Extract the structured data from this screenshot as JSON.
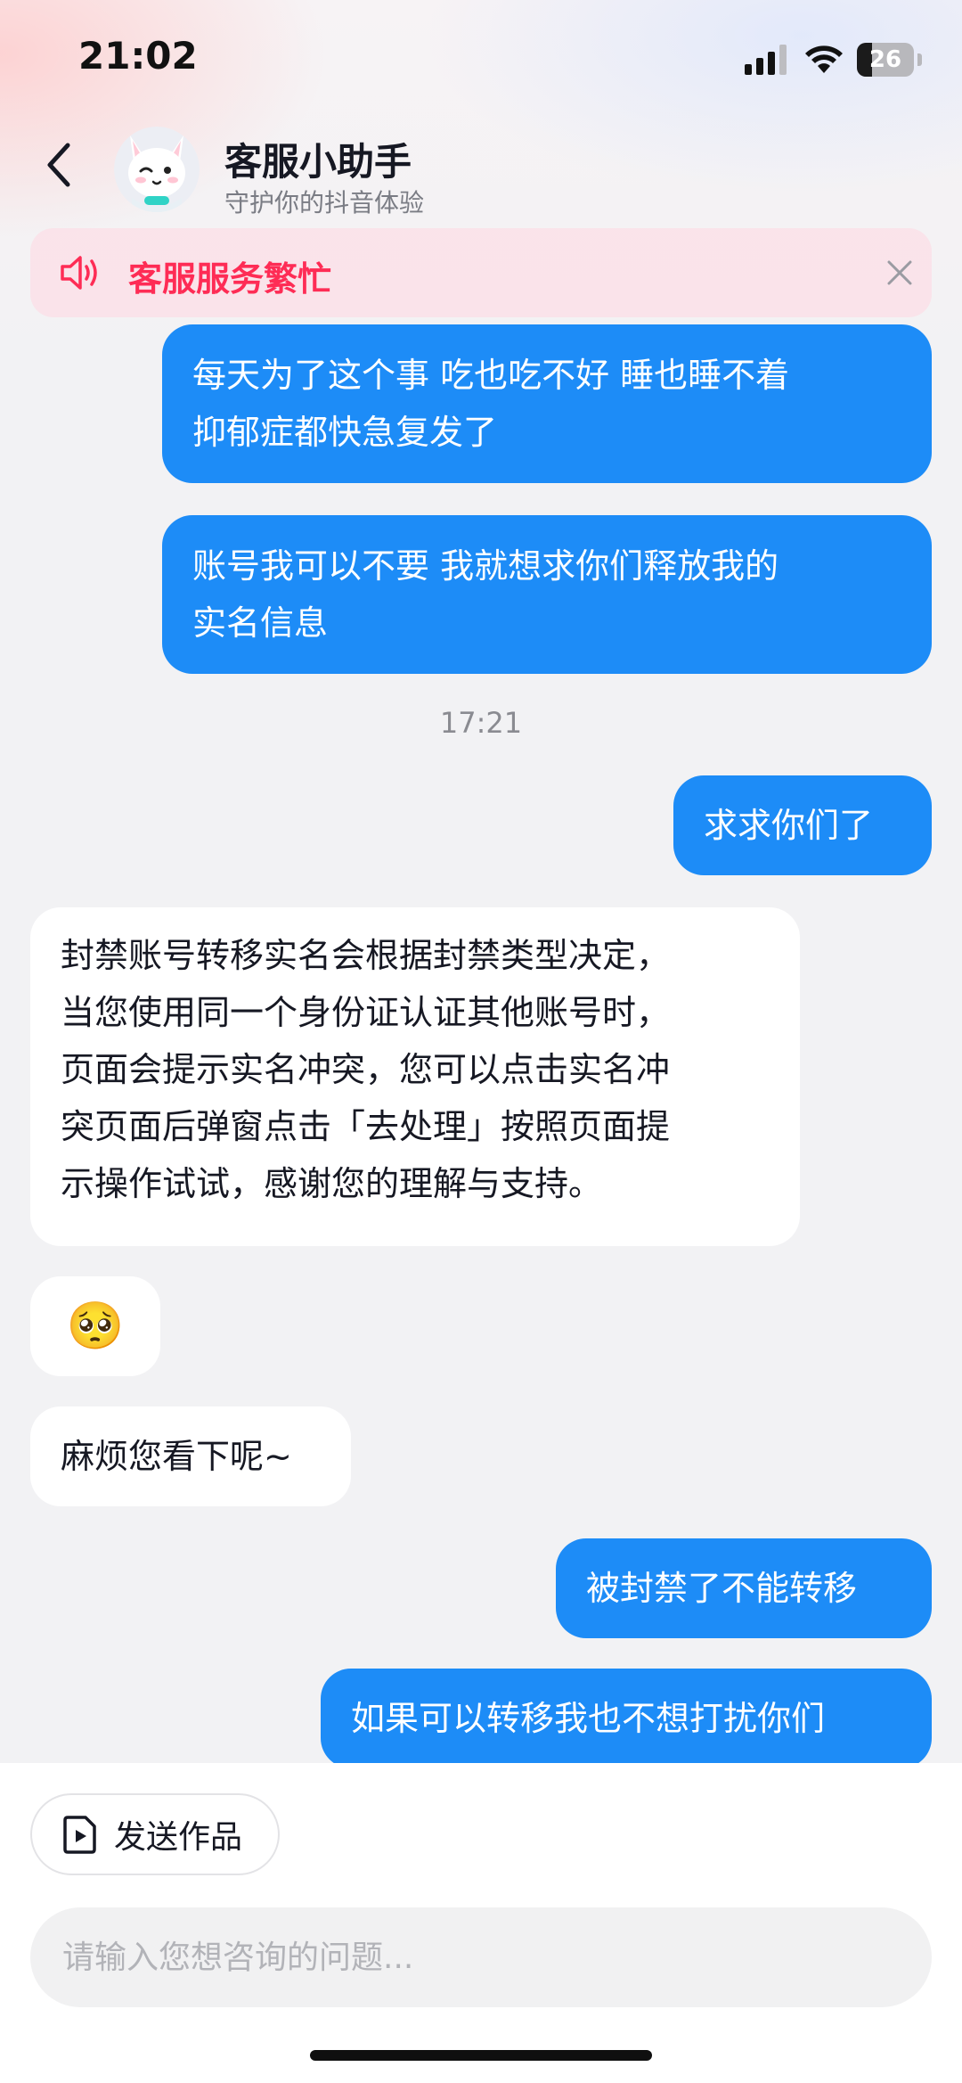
{
  "status_bar": {
    "time": "21:02",
    "battery_level": "26",
    "battery_fraction": 0.26
  },
  "header": {
    "title": "客服小助手",
    "subtitle": "守护你的抖音体验"
  },
  "notice": {
    "text": "客服服务繁忙"
  },
  "messages": [
    {
      "side": "out",
      "lines": [
        "每天为了这个事 吃也吃不好 睡也睡不着",
        "抑郁症都快急复发了"
      ]
    },
    {
      "side": "out",
      "lines": [
        "账号我可以不要 我就想求你们释放我的",
        "实名信息"
      ]
    },
    {
      "type": "timestamp",
      "text": "17:21"
    },
    {
      "side": "out",
      "lines": [
        "求求你们了"
      ]
    },
    {
      "side": "in",
      "lines": [
        "封禁账号转移实名会根据封禁类型决定，",
        "当您使用同一个身份证认证其他账号时，",
        "页面会提示实名冲突，您可以点击实名冲",
        "突页面后弹窗点击「去处理」按照页面提",
        "示操作试试，感谢您的理解与支持。"
      ]
    },
    {
      "side": "in",
      "type": "emoji",
      "lines": [
        "🥺"
      ]
    },
    {
      "side": "in",
      "lines": [
        "麻烦您看下呢~"
      ]
    },
    {
      "side": "out",
      "lines": [
        "被封禁了不能转移"
      ]
    },
    {
      "side": "out",
      "lines": [
        "如果可以转移我也不想打扰你们"
      ]
    }
  ],
  "bottom": {
    "send_work_label": "发送作品",
    "input_placeholder": "请输入您想咨询的问题..."
  },
  "colors": {
    "accent": "#fe2c55",
    "outgoing_bubble": "#1d8cf7",
    "incoming_bubble": "#ffffff"
  },
  "icons": {
    "back": "chevron-left-icon",
    "speaker": "speaker-icon",
    "close": "close-icon",
    "send_work": "video-file-icon"
  }
}
